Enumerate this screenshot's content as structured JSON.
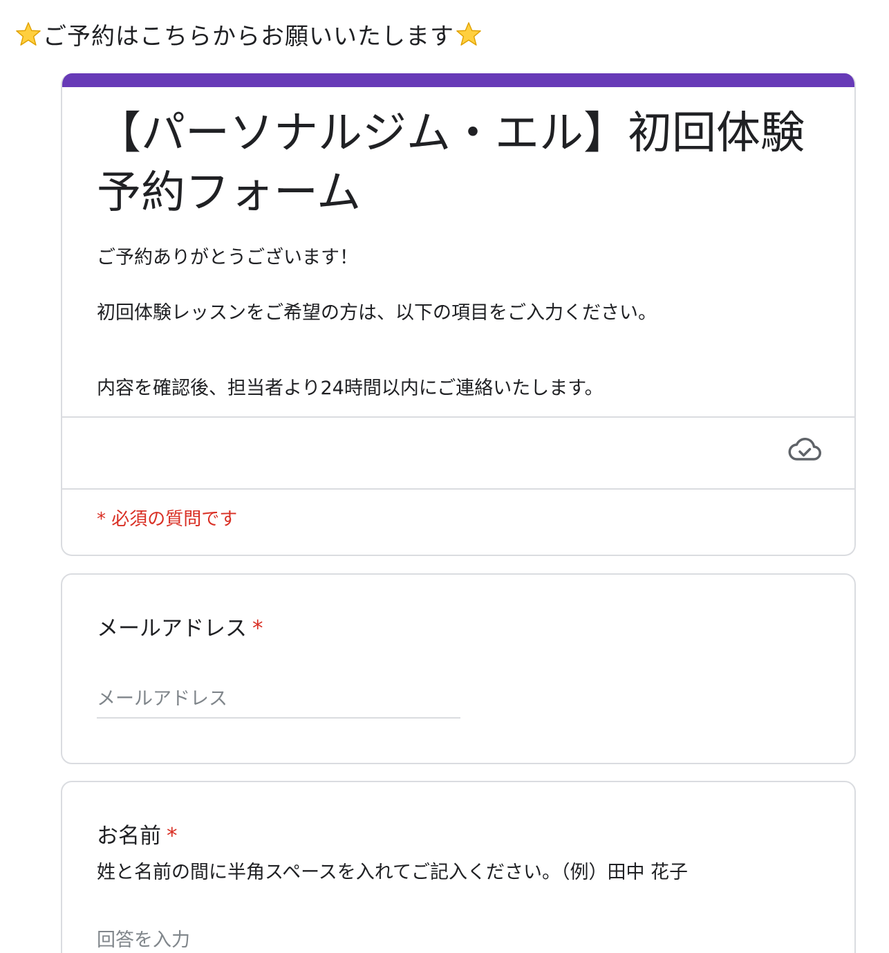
{
  "banner": {
    "text": "ご予約はこちらからお願いいたします",
    "leading_icon": "star-emoji",
    "trailing_icon": "star-emoji"
  },
  "form": {
    "accent_color": "#673ab7",
    "title": "【パーソナルジム・エル】初回体験予約フォーム",
    "description": [
      "ご予約ありがとうございます！",
      "初回体験レッスンをご希望の方は、以下の項目をご入力ください。",
      "内容を確認後、担当者より24時間以内にご連絡いたします。"
    ],
    "status_icon": "cloud-check-icon",
    "required_note": "* 必須の質問です",
    "required_color": "#d93025"
  },
  "questions": [
    {
      "title": "メールアドレス",
      "required_mark": "*",
      "placeholder": "メールアドレス"
    },
    {
      "title": "お名前",
      "required_mark": "*",
      "help": "姓と名前の間に半角スペースを入れてご記入ください。（例）田中 花子",
      "placeholder": "回答を入力"
    }
  ]
}
